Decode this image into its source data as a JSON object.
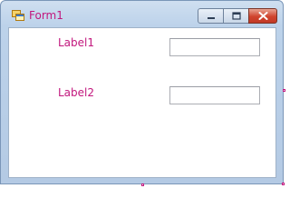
{
  "window": {
    "title": "Form1",
    "icon": "form-icon"
  },
  "caption_buttons": [
    "minimize-icon",
    "maximize-icon",
    "close-icon"
  ],
  "form": {
    "label1": "Label1",
    "label2": "Label2",
    "textbox1_value": "",
    "textbox2_value": ""
  },
  "colors": {
    "accent": "#c2177d",
    "frame": "#bcd2ea",
    "close": "#d0442e"
  }
}
